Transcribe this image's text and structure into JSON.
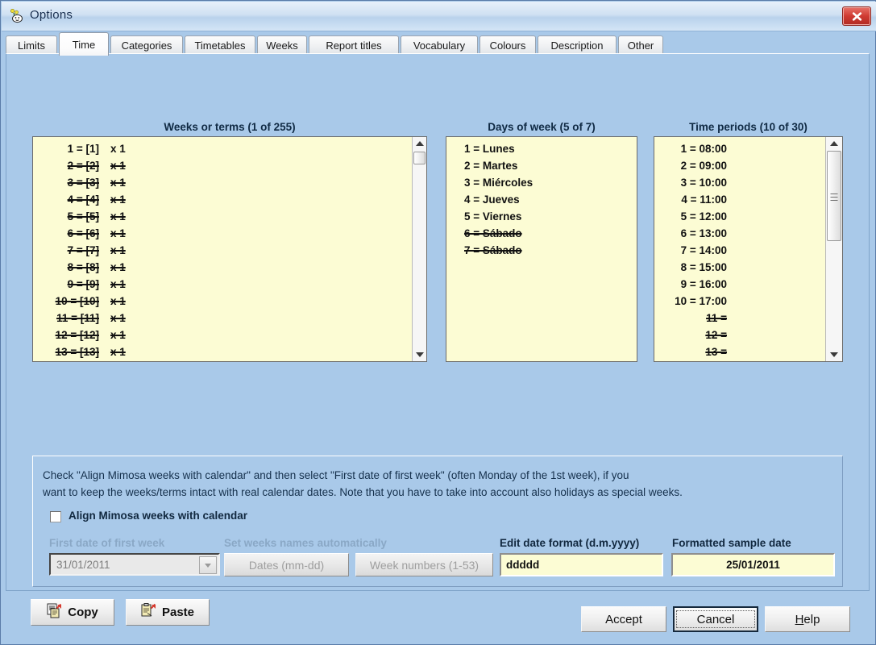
{
  "window": {
    "title": "Options",
    "app_icon": "mimosa-flower-icon",
    "close_icon": "close-icon",
    "background_color": "#a9c9e9"
  },
  "tabs": [
    {
      "label": "Limits",
      "active": false
    },
    {
      "label": "Time",
      "active": true
    },
    {
      "label": "Categories",
      "active": false
    },
    {
      "label": "Timetables",
      "active": false
    },
    {
      "label": "Weeks",
      "active": false
    },
    {
      "label": "Report titles",
      "active": false
    },
    {
      "label": "Vocabulary",
      "active": false
    },
    {
      "label": "Colours",
      "active": false
    },
    {
      "label": "Description",
      "active": false
    },
    {
      "label": "Other",
      "active": false
    }
  ],
  "weeks": {
    "title": "Weeks or terms (1 of 255)",
    "selected_count": 1,
    "total_count": 255,
    "rows": [
      {
        "label": "1 = [1]",
        "mult": "x 1",
        "struck": false
      },
      {
        "label": "2 = [2]",
        "mult": "x 1",
        "struck": true
      },
      {
        "label": "3 = [3]",
        "mult": "x 1",
        "struck": true
      },
      {
        "label": "4 = [4]",
        "mult": "x 1",
        "struck": true
      },
      {
        "label": "5 = [5]",
        "mult": "x 1",
        "struck": true
      },
      {
        "label": "6 = [6]",
        "mult": "x 1",
        "struck": true
      },
      {
        "label": "7 = [7]",
        "mult": "x 1",
        "struck": true
      },
      {
        "label": "8 = [8]",
        "mult": "x 1",
        "struck": true
      },
      {
        "label": "9 = [9]",
        "mult": "x 1",
        "struck": true
      },
      {
        "label": "10 = [10]",
        "mult": "x 1",
        "struck": true
      },
      {
        "label": "11 = [11]",
        "mult": "x 1",
        "struck": true
      },
      {
        "label": "12 = [12]",
        "mult": "x 1",
        "struck": true
      },
      {
        "label": "13 = [13]",
        "mult": "x 1",
        "struck": true
      }
    ]
  },
  "days": {
    "title": "Days of week (5 of 7)",
    "selected_count": 5,
    "total_count": 7,
    "rows": [
      {
        "label": "1 = Lunes",
        "struck": false
      },
      {
        "label": "2 = Martes",
        "struck": false
      },
      {
        "label": "3 = Miércoles",
        "struck": false
      },
      {
        "label": "4 = Jueves",
        "struck": false
      },
      {
        "label": "5 = Viernes",
        "struck": false
      },
      {
        "label": "6 = Sábado",
        "struck": true
      },
      {
        "label": "7 = Sábado",
        "struck": true
      }
    ]
  },
  "periods": {
    "title": "Time periods (10 of 30)",
    "selected_count": 10,
    "total_count": 30,
    "rows": [
      {
        "label": "1 = 08:00",
        "struck": false
      },
      {
        "label": "2 = 09:00",
        "struck": false
      },
      {
        "label": "3 = 10:00",
        "struck": false
      },
      {
        "label": "4 = 11:00",
        "struck": false
      },
      {
        "label": "5 = 12:00",
        "struck": false
      },
      {
        "label": "6 = 13:00",
        "struck": false
      },
      {
        "label": "7 = 14:00",
        "struck": false
      },
      {
        "label": "8 = 15:00",
        "struck": false
      },
      {
        "label": "9 = 16:00",
        "struck": false
      },
      {
        "label": "10 = 17:00",
        "struck": false
      },
      {
        "label": "11 = ",
        "struck": true
      },
      {
        "label": "12 = ",
        "struck": true
      },
      {
        "label": "13 = ",
        "struck": true
      }
    ]
  },
  "info": {
    "line1": "Check \"Align Mimosa weeks with calendar\" and then select  \"First date of first week\" (often Monday of the 1st week), if you",
    "line2": "want to keep the weeks/terms intact with real calendar dates. Note that you have to take into account also holidays as special weeks.",
    "align_checkbox_label": "Align Mimosa weeks with calendar",
    "align_checked": false
  },
  "form": {
    "first_date_label": "First date of first week",
    "first_date_value": "31/01/2011",
    "first_date_enabled": false,
    "auto_names_label": "Set weeks names automatically",
    "btn_dates_label": "Dates (mm-dd)",
    "btn_weeknumbers_label": "Week numbers (1-53)",
    "edit_format_label": "Edit date format (d.m.yyyy)",
    "edit_format_value": "ddddd",
    "sample_date_label": "Formatted sample date",
    "sample_date_value": "25/01/2011"
  },
  "clipboard": {
    "copy_label": "Copy",
    "paste_label": "Paste",
    "copy_icon": "copy-clipboard-icon",
    "paste_icon": "paste-clipboard-icon"
  },
  "footer": {
    "accept_label": "Accept",
    "cancel_label": "Cancel",
    "help_label_prefix": "H",
    "help_label_rest": "elp"
  }
}
